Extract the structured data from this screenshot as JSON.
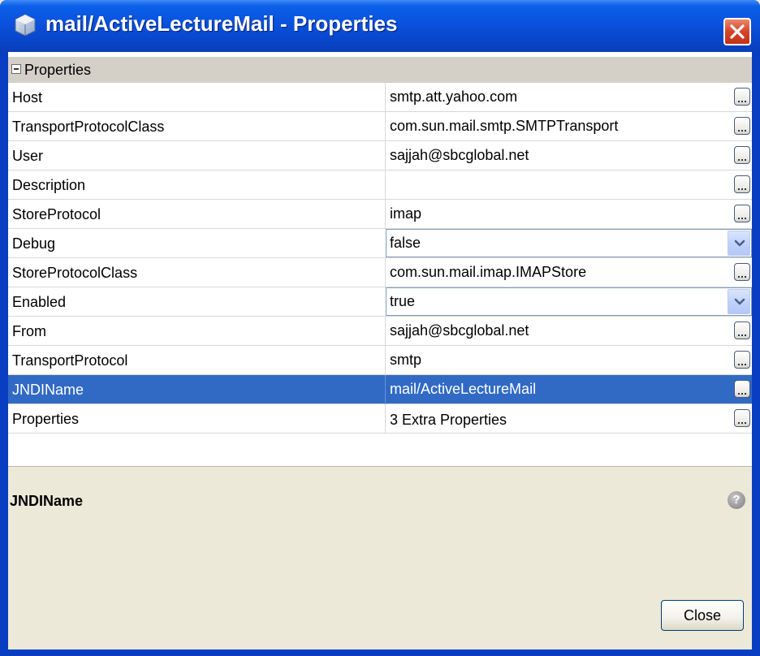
{
  "window": {
    "title": "mail/ActiveLectureMail - Properties"
  },
  "category": {
    "label": "Properties"
  },
  "rows": [
    {
      "name": "Host",
      "value": "smtp.att.yahoo.com",
      "editor": "ellipsis"
    },
    {
      "name": "TransportProtocolClass",
      "value": "com.sun.mail.smtp.SMTPTransport",
      "editor": "ellipsis"
    },
    {
      "name": "User",
      "value": "sajjah@sbcglobal.net",
      "editor": "ellipsis"
    },
    {
      "name": "Description",
      "value": "",
      "editor": "ellipsis"
    },
    {
      "name": "StoreProtocol",
      "value": "imap",
      "editor": "ellipsis"
    },
    {
      "name": "Debug",
      "value": "false",
      "editor": "combo"
    },
    {
      "name": "StoreProtocolClass",
      "value": "com.sun.mail.imap.IMAPStore",
      "editor": "ellipsis"
    },
    {
      "name": "Enabled",
      "value": "true",
      "editor": "combo"
    },
    {
      "name": "From",
      "value": "sajjah@sbcglobal.net",
      "editor": "ellipsis"
    },
    {
      "name": "TransportProtocol",
      "value": "smtp",
      "editor": "ellipsis"
    },
    {
      "name": "JNDIName",
      "value": "mail/ActiveLectureMail",
      "editor": "ellipsis",
      "selected": true
    },
    {
      "name": "Properties",
      "value": "3 Extra Properties",
      "editor": "ellipsis"
    }
  ],
  "description": {
    "title": "JNDIName",
    "help_icon": "?"
  },
  "buttons": {
    "close_label": "Close"
  },
  "colors": {
    "titlebar": "#0a52dd",
    "selection": "#316ac5",
    "close_button": "#d5442a"
  }
}
